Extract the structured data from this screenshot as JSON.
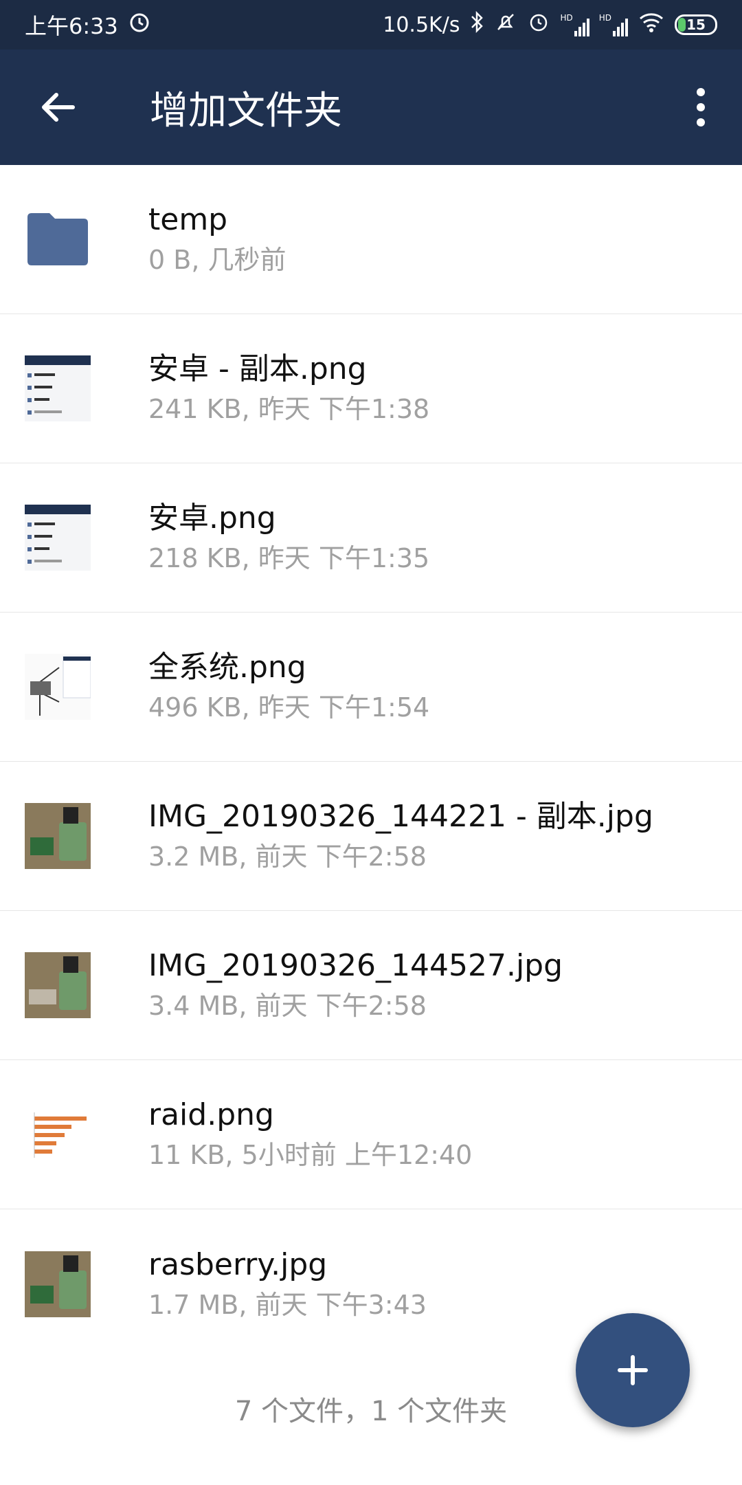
{
  "status_bar": {
    "time": "上午6:33",
    "speed": "10.5K/s",
    "signal1": "HD",
    "signal2": "HD",
    "battery": "15",
    "icons": [
      "alarm-icon",
      "bluetooth-icon",
      "mute-icon",
      "alarm-icon",
      "signal-icon",
      "signal-icon",
      "wifi-icon",
      "battery-icon"
    ]
  },
  "app_bar": {
    "title": "增加文件夹",
    "back_icon": "arrow-left-icon",
    "menu_icon": "more-vert-icon"
  },
  "files": [
    {
      "name": "temp",
      "meta": "0 B, 几秒前",
      "thumb": "folder-icon"
    },
    {
      "name": "安卓 - 副本.png",
      "meta": "241 KB, 昨天 下午1:38",
      "thumb": "screenshot-thumbnail"
    },
    {
      "name": "安卓.png",
      "meta": "218 KB, 昨天 下午1:35",
      "thumb": "screenshot-thumbnail"
    },
    {
      "name": "全系统.png",
      "meta": "496 KB, 昨天 下午1:54",
      "thumb": "diagram-thumbnail"
    },
    {
      "name": "IMG_20190326_144221 - 副本.jpg",
      "meta": "3.2 MB, 前天 下午2:58",
      "thumb": "photo-thumbnail"
    },
    {
      "name": "IMG_20190326_144527.jpg",
      "meta": "3.4 MB, 前天 下午2:58",
      "thumb": "photo-thumbnail"
    },
    {
      "name": "raid.png",
      "meta": "11 KB, 5小时前 上午12:40",
      "thumb": "chart-thumbnail"
    },
    {
      "name": "rasberry.jpg",
      "meta": "1.7 MB, 前天 下午3:43",
      "thumb": "photo-thumbnail"
    }
  ],
  "summary": "7 个文件，1 个文件夹",
  "fab": {
    "icon": "plus-icon"
  },
  "colors": {
    "status_bar_bg": "#1c2b44",
    "app_bar_bg": "#1f3150",
    "folder": "#4f6a98",
    "fab": "#33507e",
    "meta_text": "#a0a0a0"
  }
}
